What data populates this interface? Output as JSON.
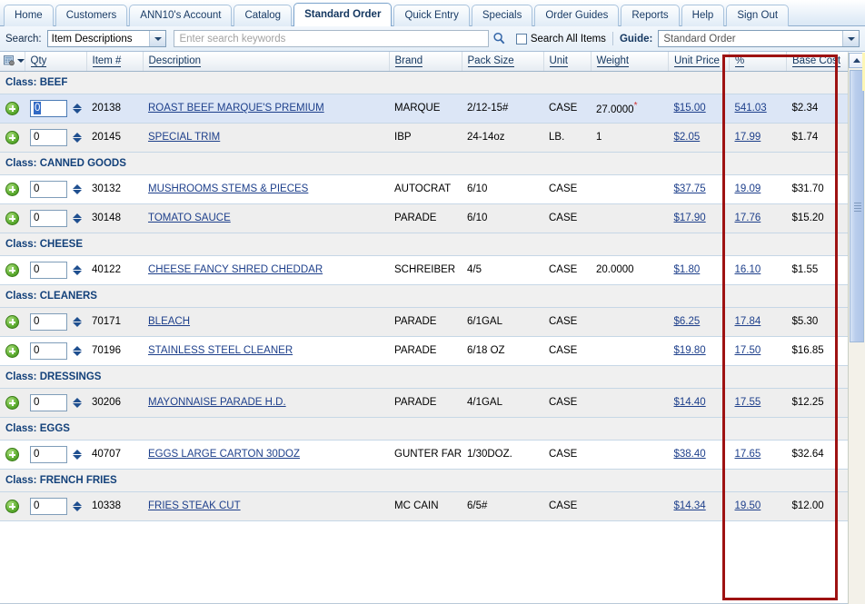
{
  "tabs": [
    {
      "label": "Home",
      "active": false
    },
    {
      "label": "Customers",
      "active": false
    },
    {
      "label": "ANN10's Account",
      "active": false
    },
    {
      "label": "Catalog",
      "active": false
    },
    {
      "label": "Standard Order",
      "active": true
    },
    {
      "label": "Quick Entry",
      "active": false
    },
    {
      "label": "Specials",
      "active": false
    },
    {
      "label": "Order Guides",
      "active": false
    },
    {
      "label": "Reports",
      "active": false
    },
    {
      "label": "Help",
      "active": false
    },
    {
      "label": "Sign Out",
      "active": false
    }
  ],
  "search": {
    "label": "Search:",
    "scope_value": "Item Descriptions",
    "keyword_value": "",
    "keyword_placeholder": "Enter search keywords",
    "magnifier_icon": "search-icon",
    "search_all_label": "Search All Items",
    "search_all_checked": false,
    "guide_label": "Guide:",
    "guide_value": "Standard Order"
  },
  "columns": [
    {
      "key": "add",
      "label": ""
    },
    {
      "key": "qty",
      "label": "Qty"
    },
    {
      "key": "item",
      "label": "Item #"
    },
    {
      "key": "desc",
      "label": "Description"
    },
    {
      "key": "brand",
      "label": "Brand"
    },
    {
      "key": "pack",
      "label": "Pack Size"
    },
    {
      "key": "unit",
      "label": "Unit"
    },
    {
      "key": "weight",
      "label": "Weight"
    },
    {
      "key": "price",
      "label": "Unit Price"
    },
    {
      "key": "pct",
      "label": "%"
    },
    {
      "key": "base",
      "label": "Base Cost"
    }
  ],
  "grid_menu_icon": "grid-settings-icon",
  "rows": [
    {
      "type": "class",
      "label": "Class: BEEF"
    },
    {
      "type": "item",
      "selected": true,
      "qty": "0",
      "qty_selected": true,
      "item": "20138",
      "desc": "ROAST BEEF MARQUE'S PREMIUM",
      "brand": "MARQUE",
      "pack": "2/12-15#",
      "unit": "CASE",
      "weight": "27.0000",
      "weight_asterisk": true,
      "price": "$15.00",
      "pct": "541.03",
      "base": "$2.34"
    },
    {
      "type": "item",
      "qty": "0",
      "item": "20145",
      "desc": "SPECIAL TRIM",
      "brand": "IBP",
      "pack": "24-14oz",
      "unit": "LB.",
      "weight": "1",
      "price": "$2.05",
      "pct": "17.99",
      "base": "$1.74"
    },
    {
      "type": "class",
      "label": "Class: CANNED GOODS"
    },
    {
      "type": "item",
      "qty": "0",
      "item": "30132",
      "desc": "MUSHROOMS STEMS & PIECES",
      "brand": "AUTOCRAT",
      "pack": "6/10",
      "unit": "CASE",
      "weight": "",
      "price": "$37.75",
      "pct": "19.09",
      "base": "$31.70"
    },
    {
      "type": "item",
      "qty": "0",
      "item": "30148",
      "desc": "TOMATO SAUCE",
      "brand": "PARADE",
      "pack": "6/10",
      "unit": "CASE",
      "weight": "",
      "price": "$17.90",
      "pct": "17.76",
      "base": "$15.20"
    },
    {
      "type": "class",
      "label": "Class: CHEESE"
    },
    {
      "type": "item",
      "qty": "0",
      "item": "40122",
      "desc": "CHEESE FANCY SHRED CHEDDAR",
      "brand": "SCHREIBER",
      "pack": "4/5",
      "unit": "CASE",
      "weight": "20.0000",
      "price": "$1.80",
      "pct": "16.10",
      "base": "$1.55"
    },
    {
      "type": "class",
      "label": "Class: CLEANERS"
    },
    {
      "type": "item",
      "qty": "0",
      "item": "70171",
      "desc": "BLEACH",
      "brand": "PARADE",
      "pack": "6/1GAL",
      "unit": "CASE",
      "weight": "",
      "price": "$6.25",
      "pct": "17.84",
      "base": "$5.30"
    },
    {
      "type": "item",
      "qty": "0",
      "item": "70196",
      "desc": "STAINLESS STEEL CLEANER",
      "brand": "PARADE",
      "pack": "6/18 OZ",
      "unit": "CASE",
      "weight": "",
      "price": "$19.80",
      "pct": "17.50",
      "base": "$16.85"
    },
    {
      "type": "class",
      "label": "Class: DRESSINGS"
    },
    {
      "type": "item",
      "qty": "0",
      "item": "30206",
      "desc": "MAYONNAISE PARADE H.D.",
      "brand": "PARADE",
      "pack": "4/1GAL",
      "unit": "CASE",
      "weight": "",
      "price": "$14.40",
      "pct": "17.55",
      "base": "$12.25"
    },
    {
      "type": "class",
      "label": "Class: EGGS"
    },
    {
      "type": "item",
      "qty": "0",
      "item": "40707",
      "desc": "EGGS LARGE CARTON 30DOZ",
      "brand": "GUNTER FARMS",
      "pack": "1/30DOZ.",
      "unit": "CASE",
      "weight": "",
      "price": "$38.40",
      "pct": "17.65",
      "base": "$32.64"
    },
    {
      "type": "class",
      "label": "Class: FRENCH FRIES"
    },
    {
      "type": "item",
      "qty": "0",
      "item": "10338",
      "desc": "FRIES STEAK CUT",
      "brand": "MC CAIN",
      "pack": "6/5#",
      "unit": "CASE",
      "weight": "",
      "price": "$14.34",
      "pct": "19.50",
      "base": "$12.00"
    }
  ],
  "scrollbar": {
    "up_arrow_icon": "chevron-up-icon",
    "thumb_grip_icon": "scroll-grip-icon"
  },
  "annotation": {
    "highlight_color": "#9e1212",
    "highlight_columns": [
      "%",
      "Base Cost"
    ]
  },
  "colors": {
    "accent_blue": "#13365f",
    "link_blue": "#1d3f8b",
    "selected_row": "#dce6f6",
    "alt_row": "#eeeeee",
    "class_header_bg": "#f0f0f0",
    "annotation_red": "#9e1212"
  }
}
